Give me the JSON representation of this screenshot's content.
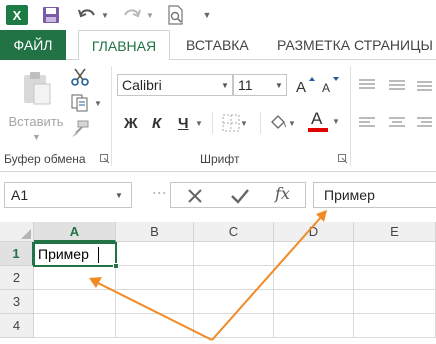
{
  "qat": {
    "logo_glyph": "X",
    "icons": [
      "excel-logo",
      "save-icon",
      "undo-icon",
      "redo-icon",
      "print-preview-icon"
    ]
  },
  "tabs": {
    "file": "ФАЙЛ",
    "home": "ГЛАВНАЯ",
    "insert": "ВСТАВКА",
    "page_layout": "РАЗМЕТКА СТРАНИЦЫ"
  },
  "ribbon": {
    "clipboard": {
      "paste_label": "Вставить",
      "group_label": "Буфер обмена"
    },
    "font": {
      "font_name": "Calibri",
      "font_size": "11",
      "bold": "Ж",
      "italic": "К",
      "underline": "Ч",
      "font_color_glyph": "A",
      "font_color": "#e30000",
      "group_label": "Шрифт"
    }
  },
  "formula_bar": {
    "name_box": "A1",
    "fx_label": "fx",
    "value": "Пример"
  },
  "grid": {
    "columns": [
      "A",
      "B",
      "C",
      "D",
      "E"
    ],
    "rows": [
      "1",
      "2",
      "3",
      "4"
    ],
    "active_cell": "A1",
    "cells": {
      "A1": "Пример"
    }
  },
  "colors": {
    "accent": "#217346",
    "annotation_arrow": "#f08a24"
  }
}
